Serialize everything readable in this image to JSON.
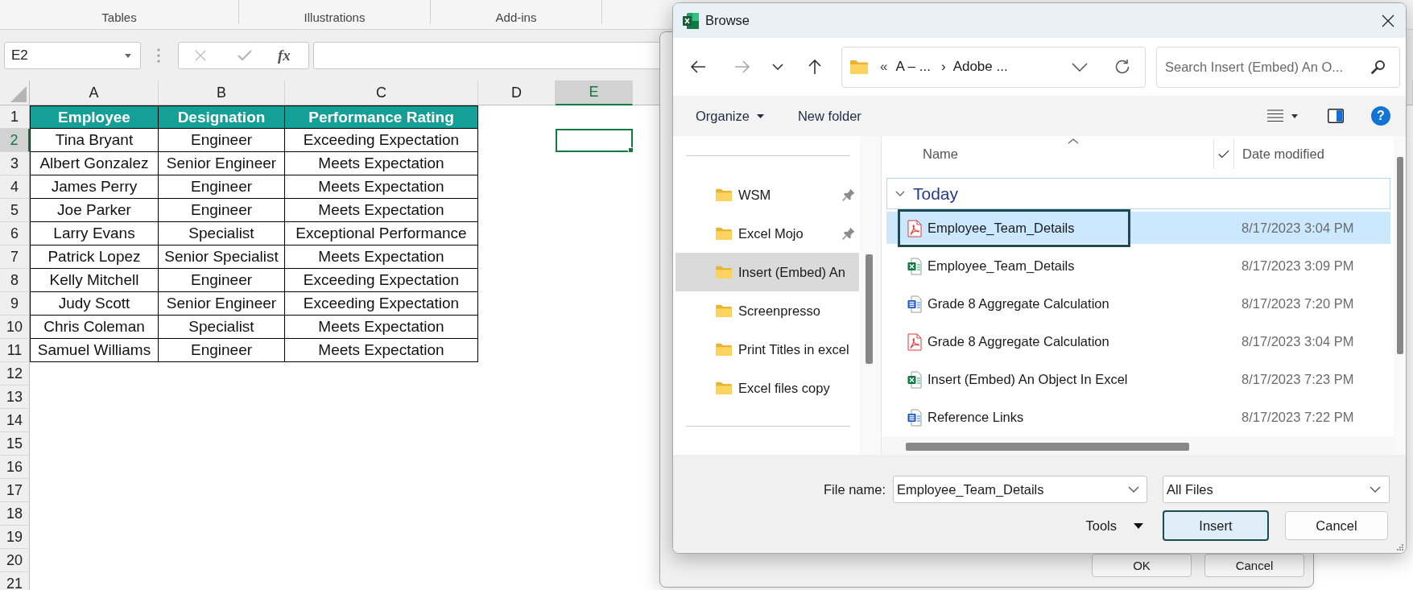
{
  "ribbon": {
    "groups": [
      "Tables",
      "Illustrations",
      "Add-ins"
    ]
  },
  "formula_bar": {
    "name_box": "E2",
    "edit_buttons": [
      {
        "kind": "cancel",
        "disabled": true
      },
      {
        "kind": "enter",
        "disabled": true
      }
    ],
    "function_label": "fx"
  },
  "spreadsheet": {
    "columns": [
      {
        "label": "A",
        "selected": false
      },
      {
        "label": "B",
        "selected": false
      },
      {
        "label": "C",
        "selected": false
      },
      {
        "label": "D",
        "selected": false
      },
      {
        "label": "E",
        "selected": true
      }
    ],
    "rows": [
      {
        "label": "1",
        "selected": false
      },
      {
        "label": "2",
        "selected": true
      },
      {
        "label": "3",
        "selected": false
      },
      {
        "label": "4",
        "selected": false
      },
      {
        "label": "5",
        "selected": false
      },
      {
        "label": "6",
        "selected": false
      },
      {
        "label": "7",
        "selected": false
      },
      {
        "label": "8",
        "selected": false
      },
      {
        "label": "9",
        "selected": false
      },
      {
        "label": "10",
        "selected": false
      },
      {
        "label": "11",
        "selected": false
      },
      {
        "label": "12",
        "selected": false
      },
      {
        "label": "13",
        "selected": false
      },
      {
        "label": "14",
        "selected": false
      },
      {
        "label": "15",
        "selected": false
      },
      {
        "label": "16",
        "selected": false
      },
      {
        "label": "17",
        "selected": false
      },
      {
        "label": "18",
        "selected": false
      },
      {
        "label": "19",
        "selected": false
      },
      {
        "label": "20",
        "selected": false
      },
      {
        "label": "21",
        "selected": false
      }
    ],
    "table": {
      "columns": [
        "Employee",
        "Designation",
        "Performance Rating"
      ],
      "rows": [
        [
          "Tina Bryant",
          "Engineer",
          "Exceeding Expectation"
        ],
        [
          "Albert Gonzalez",
          "Senior Engineer",
          "Meets Expectation"
        ],
        [
          "James Perry",
          "Engineer",
          "Meets Expectation"
        ],
        [
          "Joe Parker",
          "Engineer",
          "Meets Expectation"
        ],
        [
          "Larry Evans",
          "Specialist",
          "Exceptional Performance"
        ],
        [
          "Patrick Lopez",
          "Senior Specialist",
          "Meets Expectation"
        ],
        [
          "Kelly Mitchell",
          "Engineer",
          "Exceeding Expectation"
        ],
        [
          "Judy Scott",
          "Senior Engineer",
          "Exceeding Expectation"
        ],
        [
          "Chris Coleman",
          "Specialist",
          "Meets Expectation"
        ],
        [
          "Samuel Williams",
          "Engineer",
          "Meets Expectation"
        ]
      ]
    }
  },
  "background_dialog": {
    "buttons": [
      "OK",
      "Cancel"
    ]
  },
  "browse_dialog": {
    "title": "Browse",
    "nav_buttons": [
      {
        "kind": "back",
        "disabled": false
      },
      {
        "kind": "forward",
        "disabled": true
      },
      {
        "kind": "recent",
        "disabled": false
      },
      {
        "kind": "up",
        "disabled": false
      }
    ],
    "address": {
      "overflow": "«",
      "segments": [
        "A – ...",
        "Adobe ..."
      ],
      "separator": "›"
    },
    "search": {
      "placeholder": "Search Insert (Embed) An O..."
    },
    "toolbar": {
      "organize": "Organize",
      "new_folder": "New folder",
      "help": "?"
    },
    "nav_pane": {
      "items": [
        {
          "label": "WSM",
          "pinned": true,
          "selected": false
        },
        {
          "label": "Excel Mojo",
          "pinned": true,
          "selected": false
        },
        {
          "label": "Insert (Embed) An",
          "pinned": false,
          "selected": true
        },
        {
          "label": "Screenpresso",
          "pinned": false,
          "selected": false
        },
        {
          "label": "Print Titles in excel",
          "pinned": false,
          "selected": false
        },
        {
          "label": "Excel files copy",
          "pinned": false,
          "selected": false
        }
      ]
    },
    "file_list": {
      "columns": [
        {
          "label": "Name",
          "sorted": true
        },
        {
          "label": "Date modified",
          "sorted": false
        }
      ],
      "group": {
        "label": "Today",
        "expanded": true
      },
      "files": [
        {
          "kind": "pdf",
          "name": "Employee_Team_Details",
          "date": "8/17/2023 3:04 PM",
          "selected": true,
          "focused": true
        },
        {
          "kind": "spreadsheet",
          "name": "Employee_Team_Details",
          "date": "8/17/2023 3:09 PM",
          "selected": false,
          "focused": false
        },
        {
          "kind": "document",
          "name": "Grade 8 Aggregate Calculation",
          "date": "8/17/2023 7:20 PM",
          "selected": false,
          "focused": false
        },
        {
          "kind": "pdf",
          "name": "Grade 8 Aggregate Calculation",
          "date": "8/17/2023 3:04 PM",
          "selected": false,
          "focused": false
        },
        {
          "kind": "spreadsheet",
          "name": "Insert (Embed) An Object In Excel",
          "date": "8/17/2023 7:23 PM",
          "selected": false,
          "focused": false
        },
        {
          "kind": "document",
          "name": "Reference Links",
          "date": "8/17/2023 7:22 PM",
          "selected": false,
          "focused": false
        }
      ]
    },
    "file_name": {
      "label": "File name:",
      "value": "Employee_Team_Details"
    },
    "file_type": {
      "value": "All Files"
    },
    "tools": "Tools",
    "buttons": [
      {
        "label": "Insert",
        "default": true
      },
      {
        "label": "Cancel",
        "default": false
      }
    ]
  }
}
